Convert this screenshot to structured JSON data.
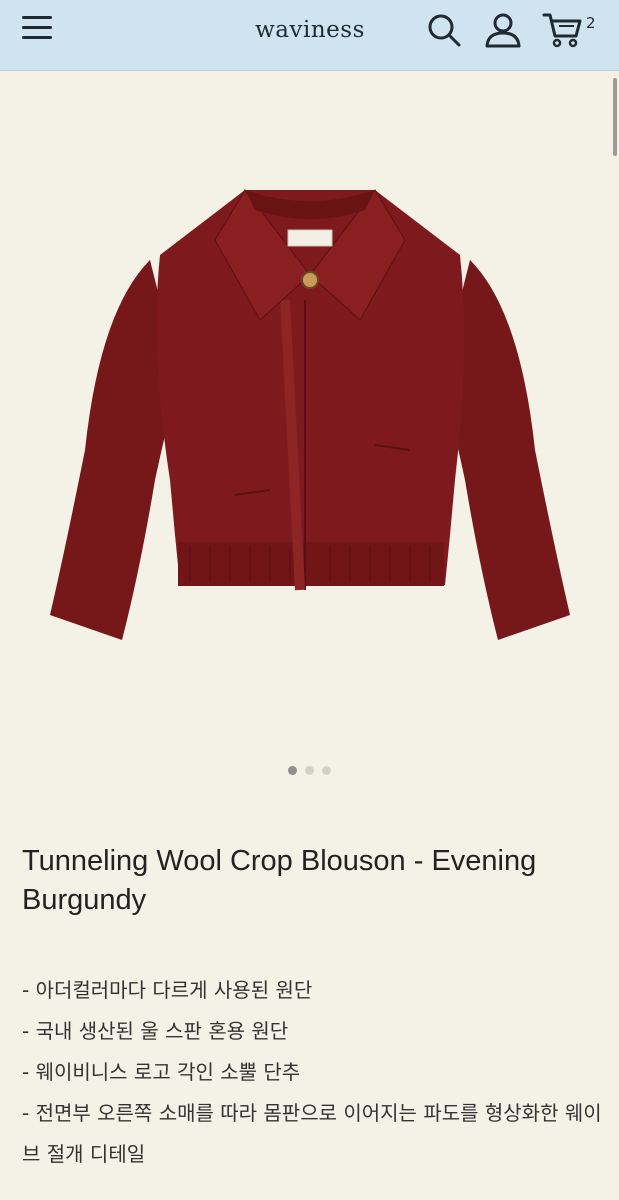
{
  "header": {
    "brand": "waviness",
    "cart_count": "2"
  },
  "icons": {
    "menu": "hamburger-menu-icon",
    "search": "search-icon",
    "account": "user-icon",
    "cart": "cart-icon"
  },
  "gallery": {
    "image": "burgundy cropped wool blouson jacket",
    "total_images": 3,
    "active_index": 0
  },
  "product": {
    "title": "Tunneling Wool Crop Blouson - Evening Burgundy",
    "description": [
      "- 아더컬러마다 다르게 사용된 원단",
      "- 국내 생산된 울 스판 혼용 원단",
      "- 웨이비니스 로고 각인 소뿔 단추",
      "- 전면부 오른쪽 소매를 따라 몸판으로 이어지는 파도를 형상화한 웨이브 절개 디테일"
    ]
  },
  "colors": {
    "header_bg": "#cfe3f1",
    "page_bg": "#f4f1e7",
    "jacket": "#7e1a1d",
    "active_dot": "#8e8e8e",
    "inactive_dot": "#d3d0c8"
  }
}
